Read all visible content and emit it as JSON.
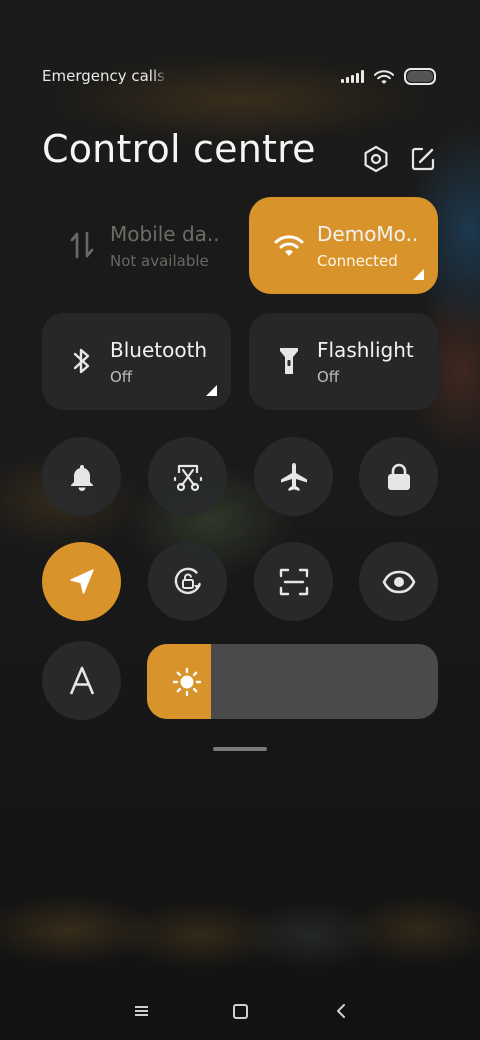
{
  "status_bar": {
    "carrier_text": "Emergency calls only",
    "signal_icon": "signal-bars-icon",
    "wifi_icon": "wifi-icon",
    "battery_icon": "battery-icon"
  },
  "header": {
    "title": "Control centre",
    "settings_icon": "settings-hexagon-icon",
    "edit_icon": "edit-icon"
  },
  "tiles": {
    "mobile_data": {
      "title": "Mobile da..",
      "subtitle": "Not available",
      "icon": "mobile-data-arrows-icon",
      "state": "disabled"
    },
    "wifi": {
      "title": "DemoMo..",
      "subtitle": "Connected",
      "icon": "wifi-icon",
      "state": "on"
    },
    "bluetooth": {
      "title": "Bluetooth",
      "subtitle": "Off",
      "icon": "bluetooth-icon",
      "state": "off"
    },
    "flashlight": {
      "title": "Flashlight",
      "subtitle": "Off",
      "icon": "flashlight-icon",
      "state": "off"
    }
  },
  "toggles": [
    {
      "name": "ring-mode",
      "icon": "bell-icon",
      "active": false
    },
    {
      "name": "screenshot",
      "icon": "scissors-icon",
      "active": false
    },
    {
      "name": "airplane-mode",
      "icon": "airplane-icon",
      "active": false
    },
    {
      "name": "lock-screen",
      "icon": "lock-icon",
      "active": false
    },
    {
      "name": "location",
      "icon": "location-arrow-icon",
      "active": true
    },
    {
      "name": "auto-rotate",
      "icon": "rotation-lock-icon",
      "active": false
    },
    {
      "name": "scanner",
      "icon": "scan-frame-icon",
      "active": false
    },
    {
      "name": "reading-mode",
      "icon": "eye-icon",
      "active": false
    },
    {
      "name": "auto-brightness",
      "icon": "letter-a-icon",
      "label": "A",
      "active": false
    }
  ],
  "brightness": {
    "level": 0.22,
    "icon": "sun-icon"
  },
  "nav_bar": {
    "menu_icon": "menu-icon",
    "home_icon": "home-icon",
    "back_icon": "back-icon"
  },
  "colors": {
    "accent": "#d8932a",
    "tile_bg": "#26282a",
    "slider_track": "#4a4a4c",
    "text_primary": "#f2f2f2",
    "text_secondary": "#bdbdbd"
  }
}
